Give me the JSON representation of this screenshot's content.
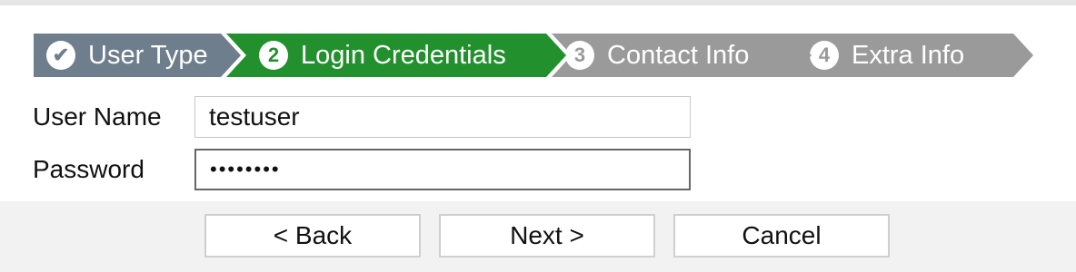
{
  "wizard": {
    "steps": [
      {
        "number": "✔",
        "label": "User Type",
        "state": "completed",
        "color": "#6e7e8d"
      },
      {
        "number": "2",
        "label": "Login Credentials",
        "state": "active",
        "color": "#22902d"
      },
      {
        "number": "3",
        "label": "Contact Info",
        "state": "pending",
        "color": "#9a9a9a"
      },
      {
        "number": "4",
        "label": "Extra Info",
        "state": "pending",
        "color": "#9a9a9a"
      }
    ]
  },
  "form": {
    "username_label": "User Name",
    "username_value": "testuser",
    "password_label": "Password",
    "password_value": "••••••••"
  },
  "footer": {
    "back_label": "< Back",
    "next_label": "Next >",
    "cancel_label": "Cancel"
  }
}
